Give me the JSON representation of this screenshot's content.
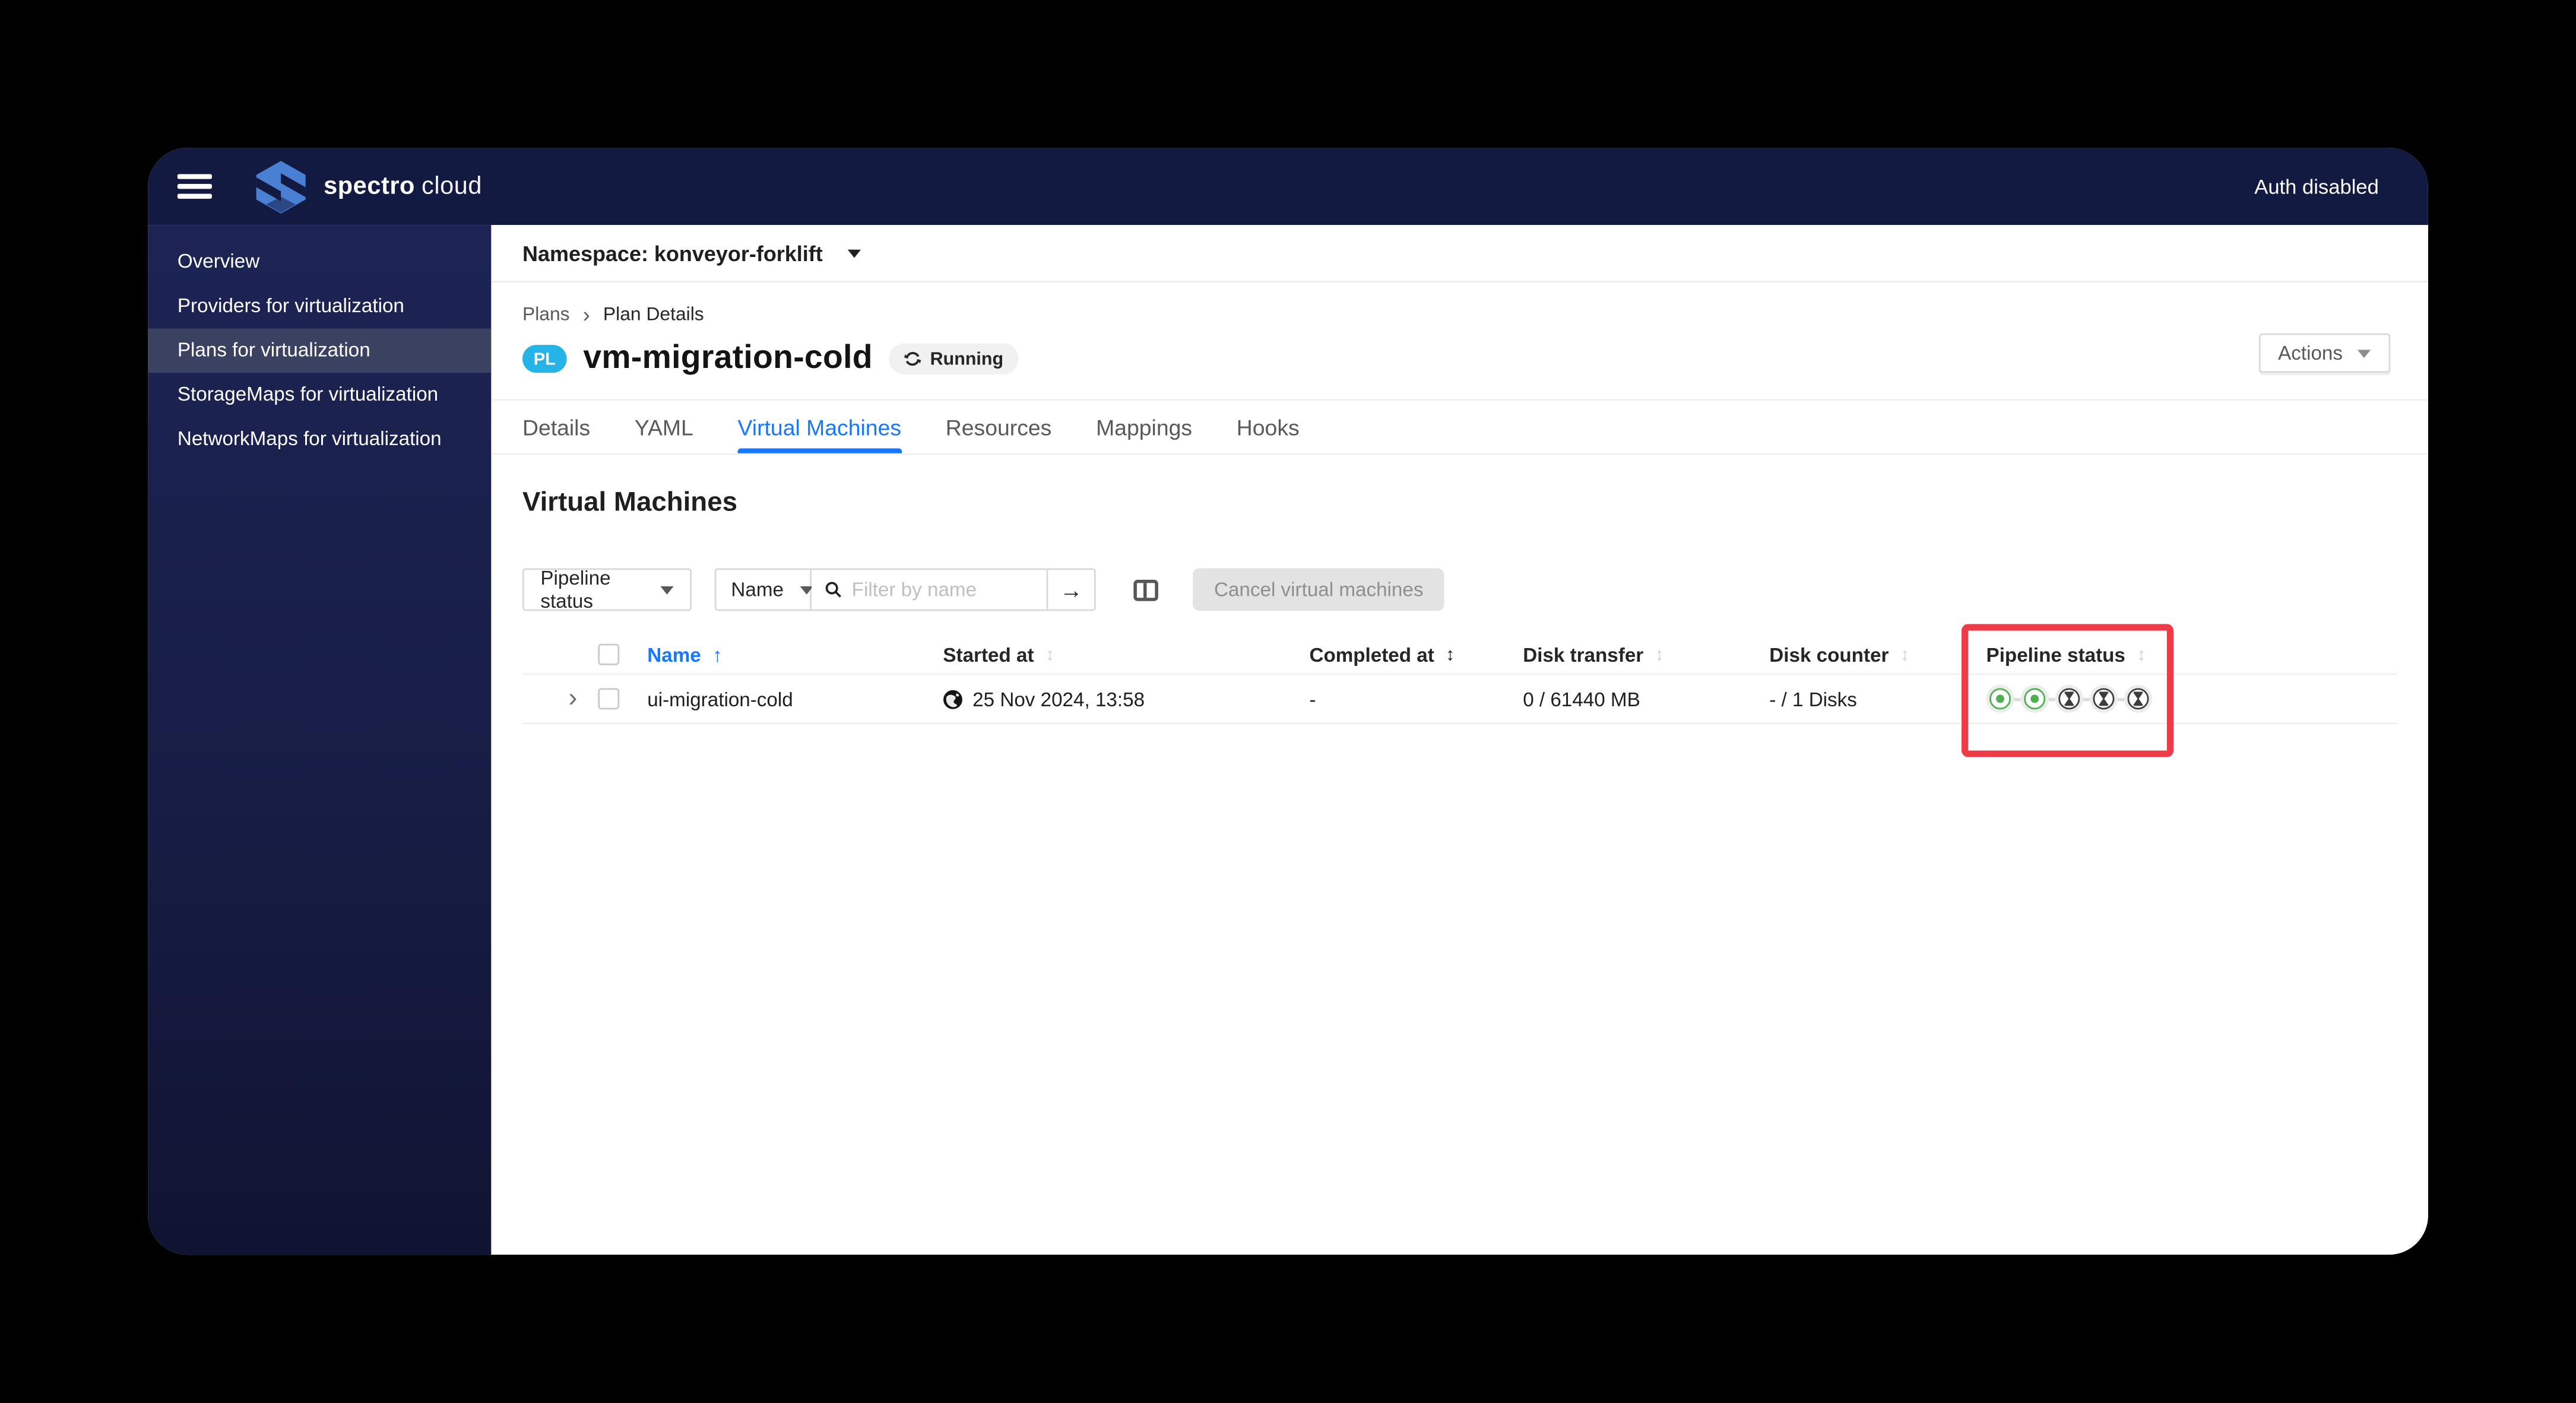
{
  "topbar": {
    "brand_primary": "spectro",
    "brand_secondary": "cloud",
    "auth_status": "Auth disabled"
  },
  "sidebar": {
    "items": [
      {
        "label": "Overview",
        "active": false
      },
      {
        "label": "Providers for virtualization",
        "active": false
      },
      {
        "label": "Plans for virtualization",
        "active": true
      },
      {
        "label": "StorageMaps for virtualization",
        "active": false
      },
      {
        "label": "NetworkMaps for virtualization",
        "active": false
      }
    ]
  },
  "namespace_bar": {
    "label": "Namespace: konveyor-forklift"
  },
  "breadcrumb": {
    "items": [
      "Plans",
      "Plan Details"
    ],
    "separator": "›"
  },
  "plan_header": {
    "badge": "PL",
    "title": "vm-migration-cold",
    "status_label": "Running",
    "actions_label": "Actions"
  },
  "tabs": [
    {
      "label": "Details",
      "active": false
    },
    {
      "label": "YAML",
      "active": false
    },
    {
      "label": "Virtual Machines",
      "active": true
    },
    {
      "label": "Resources",
      "active": false
    },
    {
      "label": "Mappings",
      "active": false
    },
    {
      "label": "Hooks",
      "active": false
    }
  ],
  "content": {
    "section_title": "Virtual Machines"
  },
  "filters": {
    "pipeline_status_label": "Pipeline status",
    "field_label": "Name",
    "search_placeholder": "Filter by name",
    "go_arrow": "→",
    "cancel_button": "Cancel virtual machines"
  },
  "table": {
    "columns": [
      {
        "label": "Name",
        "sort": "ascending",
        "accent": true
      },
      {
        "label": "Started at",
        "sort": "none"
      },
      {
        "label": "Completed at",
        "sort": "none",
        "sort_icon_dark": true
      },
      {
        "label": "Disk transfer",
        "sort": "none"
      },
      {
        "label": "Disk counter",
        "sort": "none"
      },
      {
        "label": "Pipeline status",
        "sort": "none"
      }
    ],
    "sort_glyph_up": "↑",
    "sort_glyph_both": "↕",
    "rows": [
      {
        "name": "ui-migration-cold",
        "started_at": "25 Nov 2024, 13:58",
        "completed_at": "-",
        "disk_transfer": "0 / 61440 MB",
        "disk_counter": "- / 1 Disks",
        "pipeline_steps": [
          "completed",
          "completed",
          "pending",
          "pending",
          "pending"
        ]
      }
    ]
  },
  "annotation": {
    "highlight_color": "#ed3b47"
  },
  "colors": {
    "accent_blue": "#1677ff",
    "badge_cyan": "#26b3e8",
    "step_done_green": "#4caf50",
    "step_pending_dark": "#3d3d3d",
    "topbar_navy": "#131a42",
    "highlight_red": "#ed3b47"
  }
}
